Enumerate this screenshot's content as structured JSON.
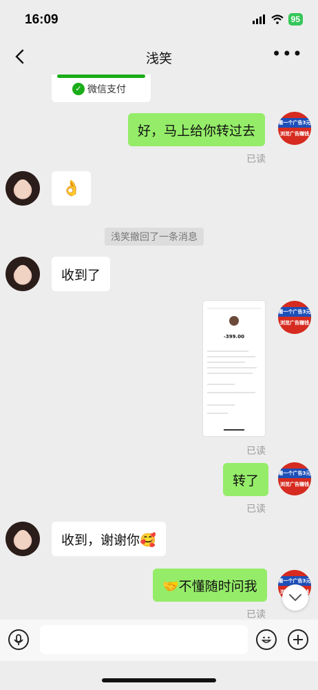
{
  "status": {
    "time": "16:09",
    "battery": "95"
  },
  "nav": {
    "title": "浅笑",
    "more": "•••"
  },
  "ad_avatar": {
    "line1": "看一个广告3元",
    "line2": "浏览广告赚钱"
  },
  "messages": {
    "wechat_pay_label": "微信支付",
    "msg1": "好，马上给你转过去",
    "read1": "已读",
    "emoji": "👌",
    "recall": "浅笑撤回了一条消息",
    "msg2": "收到了",
    "read2": "已读",
    "msg3": "转了",
    "read3": "已读",
    "msg4": "收到，谢谢你🥰",
    "msg5": "🤝不懂随时问我",
    "read5": "已读"
  },
  "receipt": {
    "amount": "-399.00"
  },
  "input": {
    "placeholder": ""
  },
  "colors": {
    "bubble_me": "#95ec69",
    "bubble_other": "#ffffff",
    "background": "#ededed",
    "wechat_green": "#1aad19"
  }
}
